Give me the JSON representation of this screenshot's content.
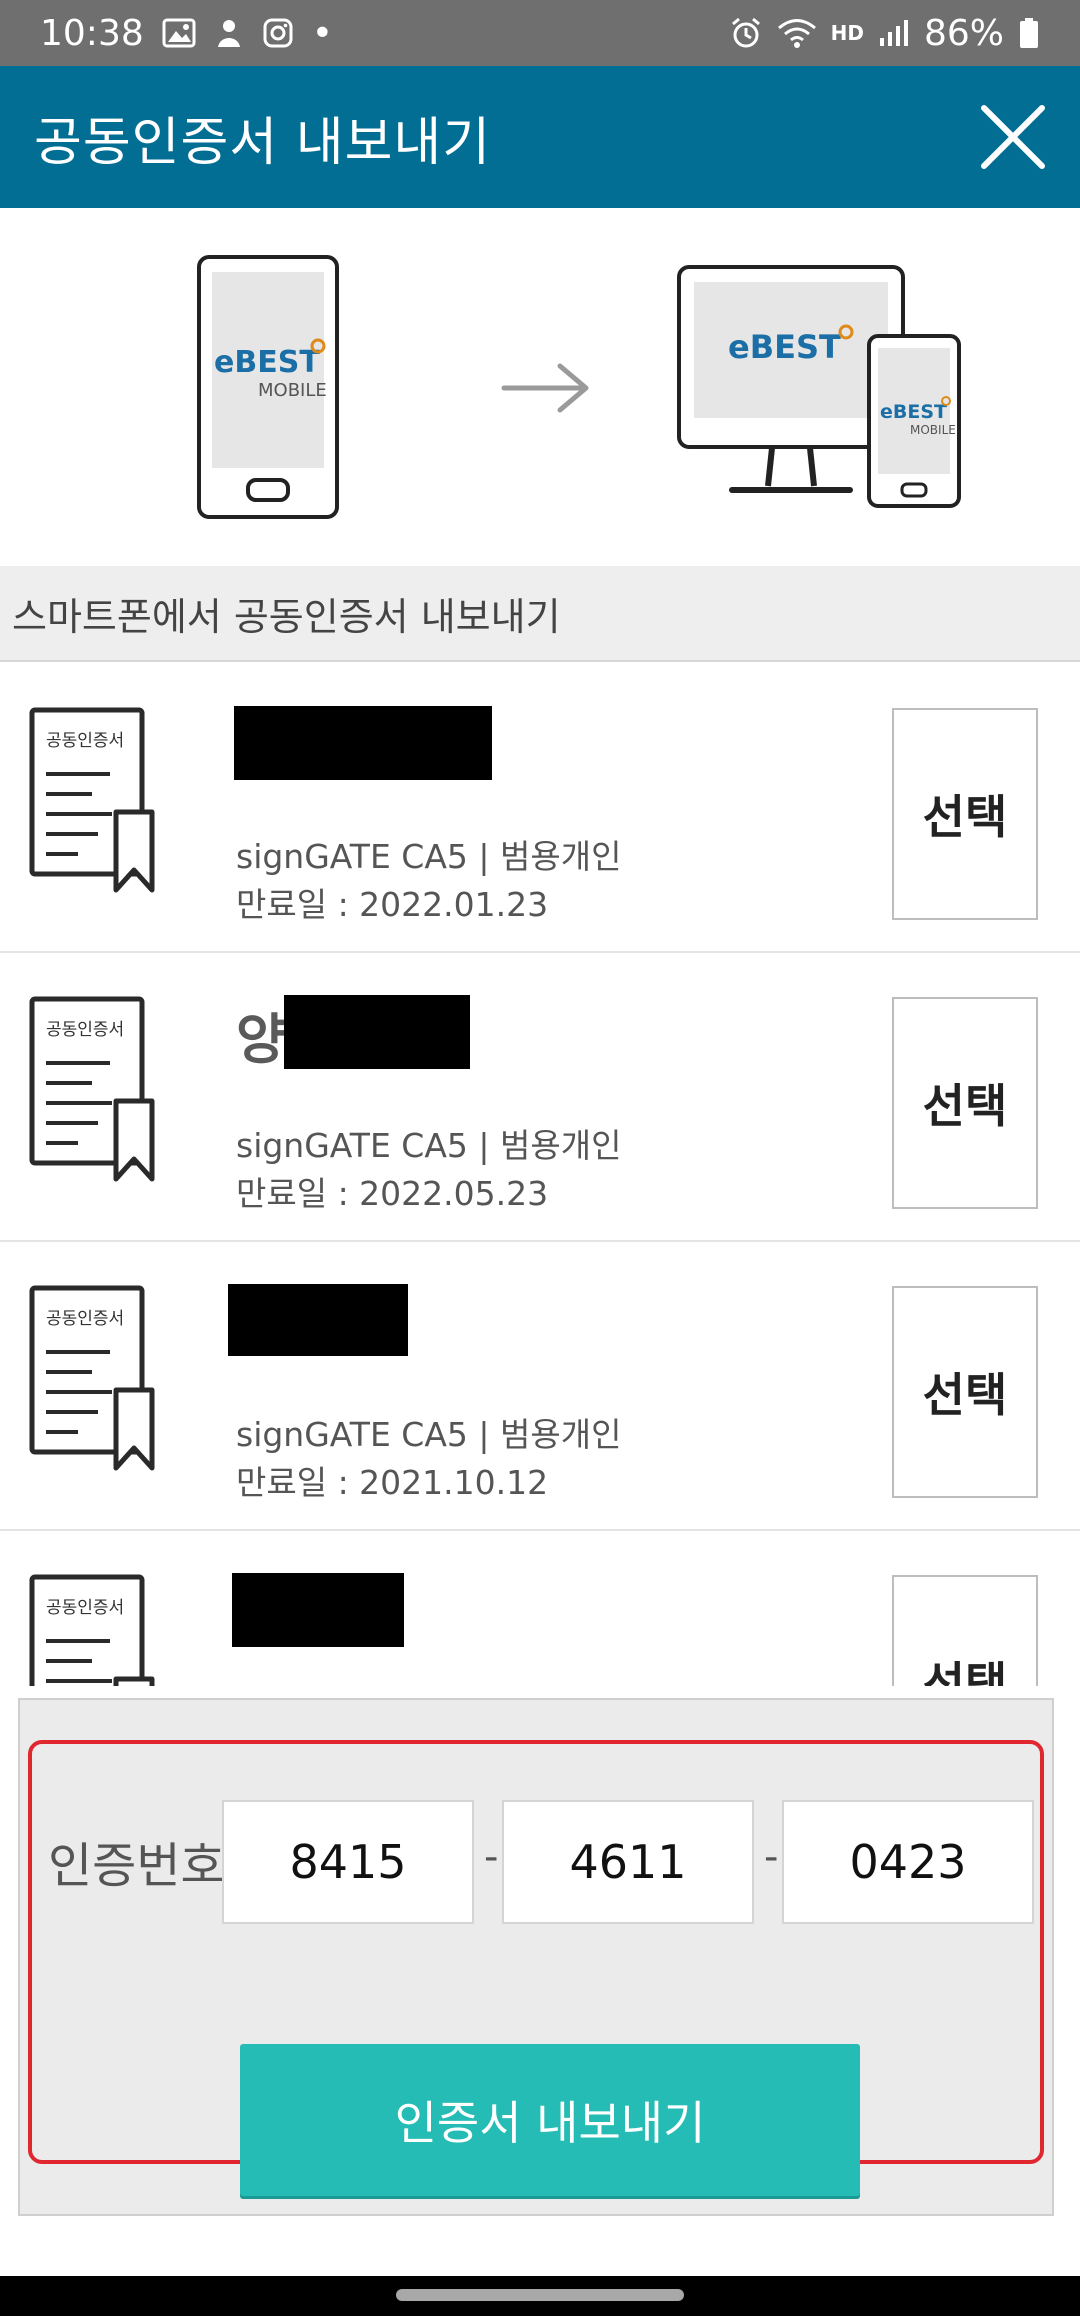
{
  "status_bar": {
    "time": "10:38",
    "dot": "•",
    "hd": "HD",
    "battery": "86%"
  },
  "header": {
    "title": "공동인증서 내보내기",
    "close_icon": "close-icon"
  },
  "illustration": {
    "phone_brand": "eBEST",
    "phone_sub": "MOBILE",
    "monitor_brand": "eBEST",
    "small_phone_brand": "eBEST",
    "small_phone_sub": "MOBILE",
    "arrow_icon": "arrow-right-icon"
  },
  "section": {
    "title": "스마트폰에서 공동인증서 내보내기"
  },
  "certificates": [
    {
      "name": "",
      "issuer": "signGATE CA5 | 범용개인",
      "expiry": "만료일 : 2022.01.23",
      "select_label": "선택",
      "icon_label": "공동인증서"
    },
    {
      "name": "양",
      "issuer": "signGATE CA5 | 범용개인",
      "expiry": "만료일 : 2022.05.23",
      "select_label": "선택",
      "icon_label": "공동인증서"
    },
    {
      "name": "",
      "issuer": "signGATE CA5 | 범용개인",
      "expiry": "만료일 : 2021.10.12",
      "select_label": "선택",
      "icon_label": "공동인증서"
    },
    {
      "name": "",
      "issuer": "",
      "expiry": "",
      "select_label": "선택",
      "icon_label": "공동인증서"
    }
  ],
  "auth": {
    "label": "인증번호",
    "code1": "8415",
    "code2": "4611",
    "code3": "0423",
    "separator": "-",
    "export_button": "인증서 내보내기"
  },
  "colors": {
    "header_bg": "#036e94",
    "button_bg": "#24bcb4",
    "highlight_border": "#e0262e"
  }
}
